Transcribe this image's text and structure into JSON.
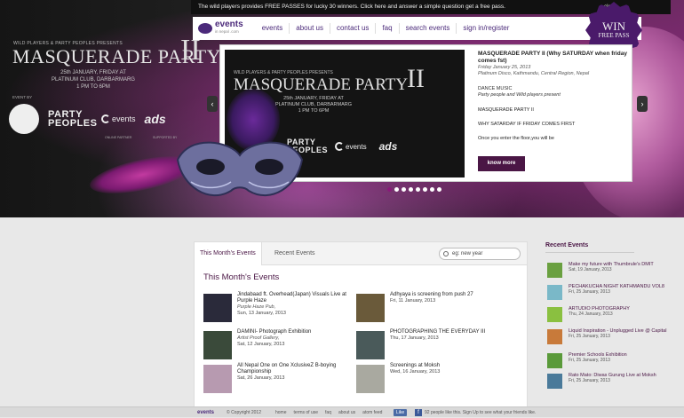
{
  "notice": {
    "text": "The wild players provides FREE PASSES for lucky 30 winners. Click here and answer a simple question get a free pass.",
    "close": "close"
  },
  "brand": {
    "name": "events",
    "tagline": "in nepal .com"
  },
  "nav": [
    "events",
    "about us",
    "contact us",
    "faq",
    "search events",
    "sign in/register"
  ],
  "win_badge": {
    "line1": "WIN",
    "line2": "FREE PASS"
  },
  "poster": {
    "presents": "WILD PLAYERS & PARTY PEOPLES PRESENTS",
    "title": "MASQUERADE PARTY",
    "roman": "II",
    "date_line1": "25th JANUARY, FRIDAY AT",
    "date_line2": "PLATINUM CLUB, DARBARMARG",
    "time": "1 PM TO 6PM",
    "event_by": "EVENT BY",
    "party_peoples": "PARTY PEOPLES",
    "online_partner": "ONLINE PARTNER",
    "supported_by": "SUPPORTED BY",
    "ads": "ads"
  },
  "featured": {
    "title": "MASQUERADE PARTY II (Why SATURDAY when friday comes fst)",
    "date": "Friday January 25, 2013",
    "venue": "Platinum Disco, Kathmandu, Central Region, Nepal",
    "genre": "DANCE MUSIC",
    "organizer": "Party people and Wild players present",
    "name": "MASQUERADE PARTY II",
    "tagline": "WHY SATARDAY IF FRIDAY COMES FIRST",
    "teaser": "Once you enter the floor,you will be",
    "button": "know more"
  },
  "tabs": {
    "active": "This Month's Events",
    "other": "Recent Events"
  },
  "search": {
    "value": "eg: new year"
  },
  "section_title": "This Month's Events",
  "events": [
    {
      "title": "Jindabaad ft. Overhead(Japan) Visuals Live at Purple Haze",
      "venue": "Purple Haze Pub,",
      "date": "Sun, 13 January, 2013",
      "color": "#2a2a3a"
    },
    {
      "title": "Adhyaya is screening from push 27",
      "venue": "",
      "date": "Fri, 11 January, 2013",
      "color": "#6a5a3a"
    },
    {
      "title": "DAMINI- Photograph Exhibition",
      "venue": "Artist Proof Gallery,",
      "date": "Sat, 12 January, 2013",
      "color": "#3a4a3a"
    },
    {
      "title": "PHOTOGRAPHING THE EVERYDAY III",
      "venue": "",
      "date": "Thu, 17 January, 2013",
      "color": "#4a5a5a"
    },
    {
      "title": "All Nepal One on One XclusiveZ B-boying Championship",
      "venue": "",
      "date": "Sat, 26 January, 2013",
      "color": "#b79ab0"
    },
    {
      "title": "Screenings at Moksh",
      "venue": "",
      "date": "Wed, 16 January, 2013",
      "color": "#a9a9a0"
    }
  ],
  "recent": {
    "title": "Recent Events",
    "items": [
      {
        "title": "Make my future with Thumbrule's DMIT",
        "date": "Sat, 19 January, 2013",
        "color": "#6aa040"
      },
      {
        "title": "PECHAKUCHA NIGHT KATHMANDU VOL8",
        "date": "Fri, 25 January, 2013",
        "color": "#7ab8c8"
      },
      {
        "title": "ARTUDIO PHOTOGRAPHY",
        "date": "Thu, 24 January, 2013",
        "color": "#8ac040"
      },
      {
        "title": "Liquid Inspiration - Unplugged Live @ Capital",
        "date": "Fri, 25 January, 2013",
        "color": "#c87a3a"
      },
      {
        "title": "Premier Schools Exhibition",
        "date": "Fri, 25 January, 2013",
        "color": "#5a9a3a"
      },
      {
        "title": "Rato Mato: Diwas Gurung Live at Moksh",
        "date": "Fri, 25 January, 2013",
        "color": "#4a7a9a"
      }
    ]
  },
  "footer": {
    "logo": "events",
    "copyright": "© Copyright 2012",
    "links": [
      "home",
      "terms of use",
      "faq",
      "about us",
      "atom feed"
    ],
    "like": "Like",
    "fb_icon": "f",
    "likes_text": "92 people like this. Sign Up to see what your friends like."
  }
}
